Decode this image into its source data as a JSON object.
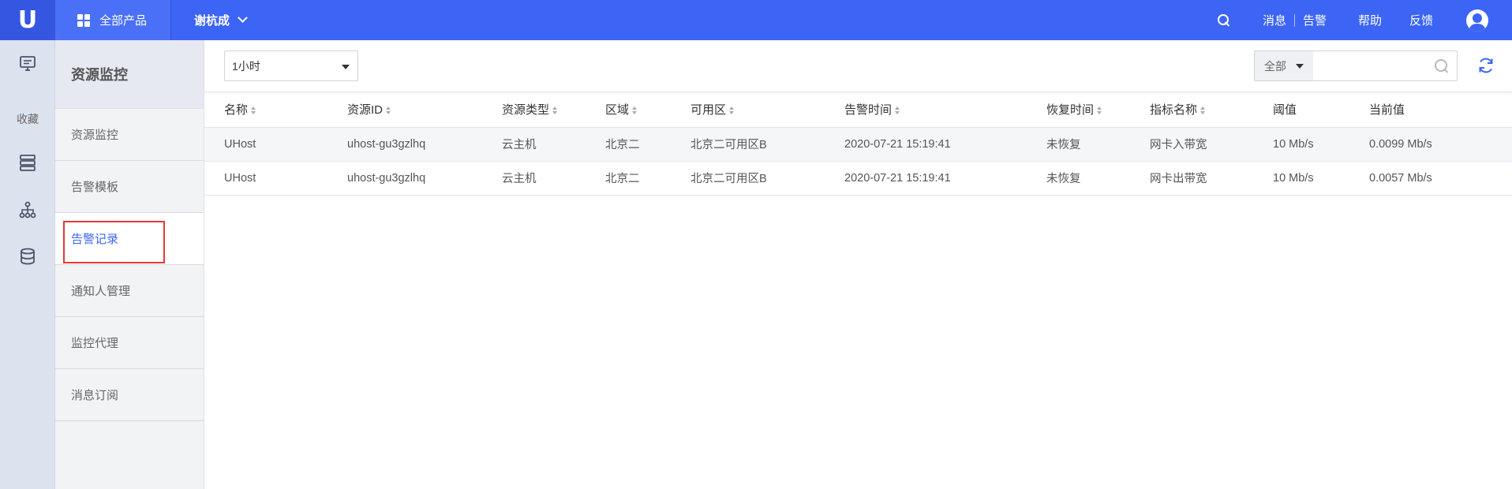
{
  "topbar": {
    "logo": "U",
    "all_products": "全部产品",
    "project": "谢杭成",
    "links": {
      "messages": "消息",
      "alerts": "告警",
      "help": "帮助",
      "feedback": "反馈"
    }
  },
  "rail": {
    "favorites": "收藏"
  },
  "subnav": {
    "title": "资源监控",
    "items": [
      {
        "label": "资源监控"
      },
      {
        "label": "告警模板"
      },
      {
        "label": "告警记录"
      },
      {
        "label": "通知人管理"
      },
      {
        "label": "监控代理"
      },
      {
        "label": "消息订阅"
      }
    ],
    "active_index": 2
  },
  "toolbar": {
    "time_range": "1小时",
    "search_category": "全部",
    "search_placeholder": ""
  },
  "table": {
    "columns": [
      "名称",
      "资源ID",
      "资源类型",
      "区域",
      "可用区",
      "告警时间",
      "恢复时间",
      "指标名称",
      "阈值",
      "当前值"
    ],
    "sortable": [
      true,
      true,
      true,
      true,
      true,
      true,
      true,
      true,
      false,
      false
    ],
    "rows": [
      [
        "UHost",
        "uhost-gu3gzlhq",
        "云主机",
        "北京二",
        "北京二可用区B",
        "2020-07-21 15:19:41",
        "未恢复",
        "网卡入带宽",
        "10 Mb/s",
        "0.0099 Mb/s"
      ],
      [
        "UHost",
        "uhost-gu3gzlhq",
        "云主机",
        "北京二",
        "北京二可用区B",
        "2020-07-21 15:19:41",
        "未恢复",
        "网卡出带宽",
        "10 Mb/s",
        "0.0057 Mb/s"
      ]
    ]
  },
  "colors": {
    "brand": "#3c64f5",
    "highlight": "#e53935"
  }
}
